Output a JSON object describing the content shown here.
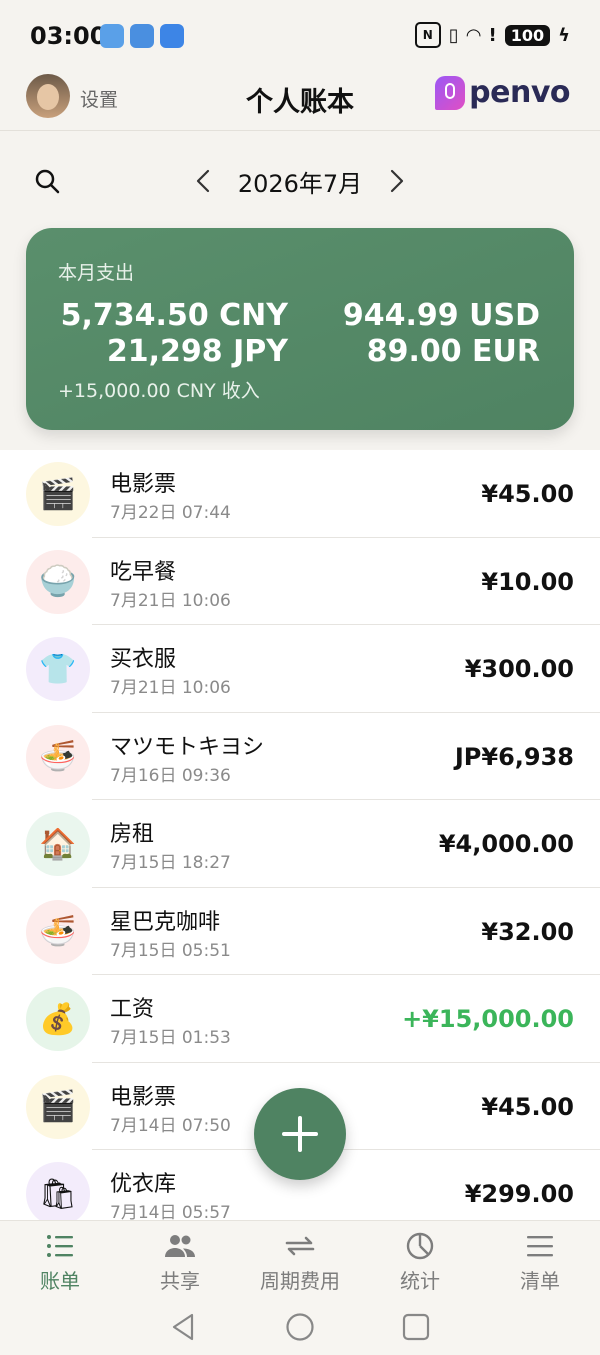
{
  "status": {
    "time": "03:00",
    "battery": "100"
  },
  "header": {
    "settings": "设置",
    "title": "个人账本",
    "logo": "penvo"
  },
  "month": {
    "label": "2026年7月"
  },
  "summary": {
    "label": "本月支出",
    "amounts": [
      "5,734.50 CNY",
      "944.99 USD",
      "21,298 JPY",
      "89.00 EUR"
    ],
    "income": "+15,000.00 CNY  收入"
  },
  "transactions": [
    {
      "title": "电影票",
      "time": "7月22日 07:44",
      "amount": "¥45.00",
      "icon": "clapperboard-icon",
      "bg": "#fdf7e0",
      "glyph": "🎬"
    },
    {
      "title": "吃早餐",
      "time": "7月21日 10:06",
      "amount": "¥10.00",
      "icon": "rice-bowl-icon",
      "bg": "#fdeceb",
      "glyph": "🍚"
    },
    {
      "title": "买衣服",
      "time": "7月21日 10:06",
      "amount": "¥300.00",
      "icon": "tshirt-icon",
      "bg": "#f3ecfb",
      "glyph": "👕"
    },
    {
      "title": "マツモトキヨシ",
      "time": "7月16日 09:36",
      "amount": "JP¥6,938",
      "icon": "noodle-bowl-icon",
      "bg": "#fdeceb",
      "glyph": "🍜"
    },
    {
      "title": "房租",
      "time": "7月15日 18:27",
      "amount": "¥4,000.00",
      "icon": "house-icon",
      "bg": "#eaf6ee",
      "glyph": "🏠"
    },
    {
      "title": "星巴克咖啡",
      "time": "7月15日 05:51",
      "amount": "¥32.00",
      "icon": "noodle-bowl-icon",
      "bg": "#fdeceb",
      "glyph": "🍜"
    },
    {
      "title": "工资",
      "time": "7月15日 01:53",
      "amount": "+¥15,000.00",
      "icon": "money-bag-icon",
      "bg": "#e6f5e9",
      "glyph": "💰",
      "positive": true
    },
    {
      "title": "电影票",
      "time": "7月14日 07:50",
      "amount": "¥45.00",
      "icon": "clapperboard-icon",
      "bg": "#fdf7e0",
      "glyph": "🎬"
    },
    {
      "title": "优衣库",
      "time": "7月14日 05:57",
      "amount": "¥299.00",
      "icon": "shopping-bags-icon",
      "bg": "#f3ecfb",
      "glyph": "🛍"
    }
  ],
  "tabs": [
    {
      "label": "账单",
      "icon": "list-icon",
      "active": true
    },
    {
      "label": "共享",
      "icon": "people-icon"
    },
    {
      "label": "周期费用",
      "icon": "repeat-icon"
    },
    {
      "label": "统计",
      "icon": "pie-chart-icon"
    },
    {
      "label": "清单",
      "icon": "checklist-icon"
    }
  ],
  "colors": {
    "accent": "#4f8362",
    "positive": "#3bb55a"
  }
}
